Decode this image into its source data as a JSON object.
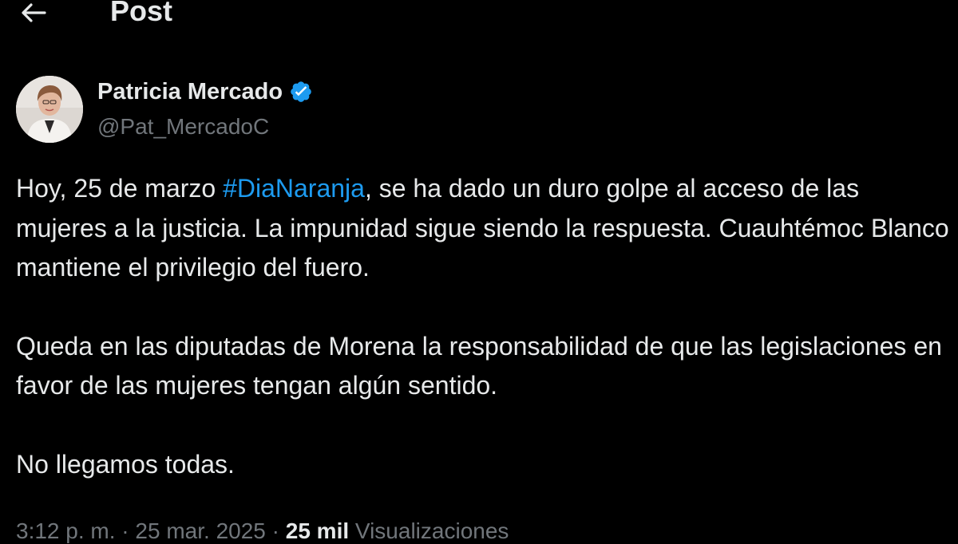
{
  "header": {
    "title": "Post",
    "back_icon": "arrow-left-icon"
  },
  "author": {
    "name": "Patricia Mercado",
    "handle": "@Pat_MercadoC",
    "verified_icon": "verified-badge-icon",
    "verified_color": "#1d9bf0"
  },
  "post": {
    "p1_before": "Hoy, 25 de marzo ",
    "hashtag": "#DiaNaranja",
    "p1_after": ", se ha dado un duro golpe al acceso de las mujeres a la justicia. La impunidad sigue siendo la respuesta. Cuauhtémoc Blanco mantiene el privilegio del fuero.",
    "p2": "Queda en las diputadas de Morena la responsabilidad de que las legislaciones en favor de las mujeres tengan algún sentido.",
    "p3": "No llegamos todas."
  },
  "meta": {
    "time": "3:12 p. m.",
    "separator": " · ",
    "date": "25 mar. 2025",
    "views_count": "25 mil",
    "views_label": " Visualizaciones"
  },
  "colors": {
    "background": "#000000",
    "text": "#e7e9ea",
    "secondary": "#71767b",
    "accent": "#1d9bf0"
  }
}
